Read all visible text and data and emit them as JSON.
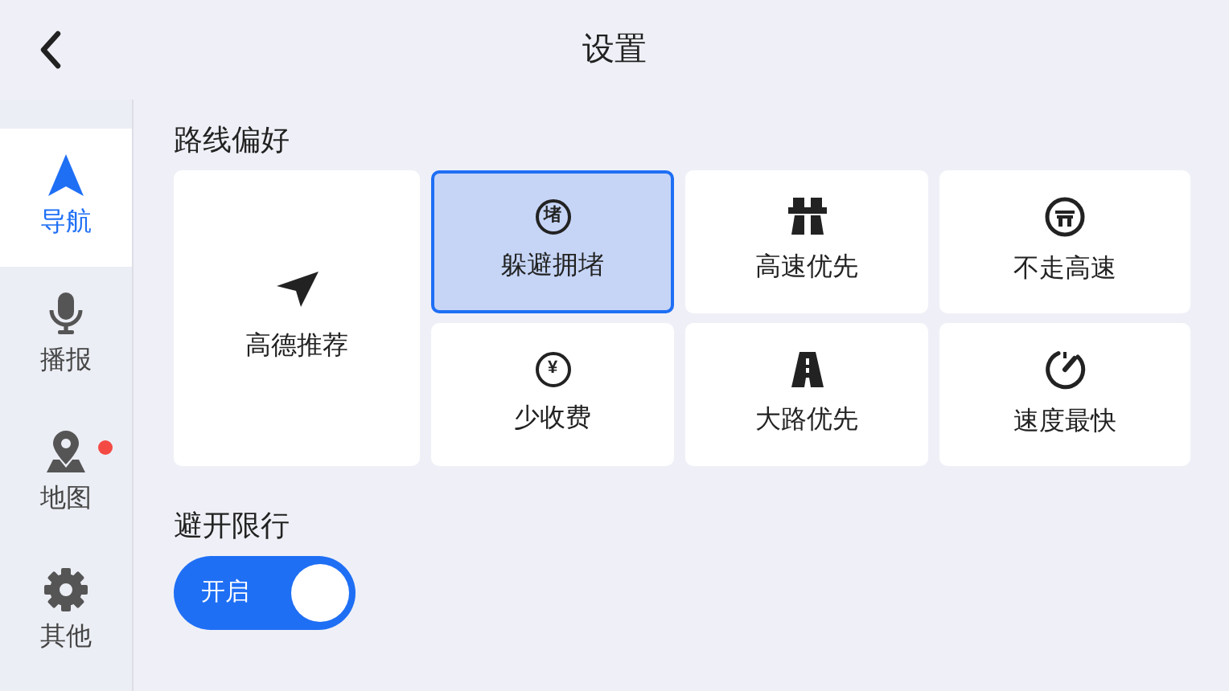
{
  "header": {
    "title": "设置"
  },
  "sidebar": {
    "items": [
      {
        "label": "导航",
        "selected": true,
        "notification_dot": false
      },
      {
        "label": "播报",
        "selected": false,
        "notification_dot": false
      },
      {
        "label": "地图",
        "selected": false,
        "notification_dot": true
      },
      {
        "label": "其他",
        "selected": false,
        "notification_dot": false
      }
    ]
  },
  "route_preference": {
    "title": "路线偏好",
    "options": [
      {
        "label": "高德推荐",
        "kind": "large",
        "selected": false
      },
      {
        "label": "躲避拥堵",
        "icon_text": "堵",
        "kind": "small",
        "selected": true
      },
      {
        "label": "高速优先",
        "kind": "small",
        "selected": false
      },
      {
        "label": "不走高速",
        "kind": "small",
        "selected": false
      },
      {
        "label": "少收费",
        "icon_text": "¥",
        "kind": "small",
        "selected": false
      },
      {
        "label": "大路优先",
        "kind": "small",
        "selected": false
      },
      {
        "label": "速度最快",
        "kind": "small",
        "selected": false
      }
    ]
  },
  "restriction": {
    "title": "避开限行",
    "toggle": {
      "label": "开启",
      "on": true
    }
  }
}
